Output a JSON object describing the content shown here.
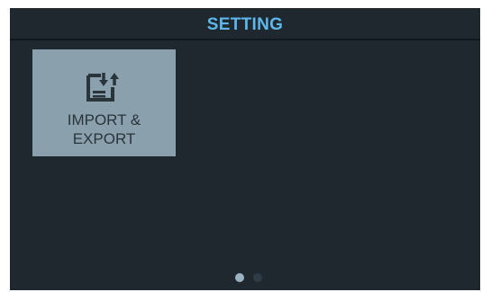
{
  "header": {
    "title": "SETTING"
  },
  "tiles": [
    {
      "icon": "import-export-icon",
      "label_line1": "IMPORT &",
      "label_line2": "EXPORT"
    }
  ],
  "pager": {
    "pages": 2,
    "current": 1
  },
  "colors": {
    "background": "#1f282f",
    "title": "#5db7ea",
    "tile": "#8aa0ad",
    "dot_active": "#9bb3c0",
    "dot_inactive": "#2e3b44"
  }
}
